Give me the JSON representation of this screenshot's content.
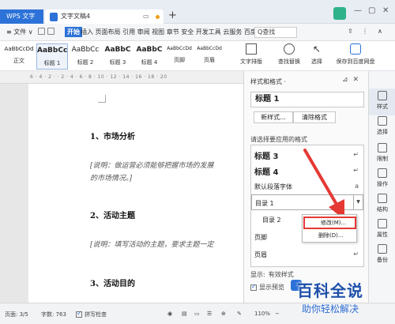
{
  "titlebar": {
    "app_tab": "WPS 文字",
    "doc_tab": "文字文稿4",
    "add_tab": "+"
  },
  "menubar": {
    "file": "≡ 文件 ∨",
    "start": "开始",
    "items": "插入  页面布局  引用  审阅  视图  章节  安全  开发工具  云服务  百度P",
    "search": "Q查找"
  },
  "ribbon": {
    "styles": [
      {
        "sample": "AaBbCcDd",
        "label": "正文"
      },
      {
        "sample": "AaBbCc",
        "label": "标题 1"
      },
      {
        "sample": "AaBbCc",
        "label": "标题 2"
      },
      {
        "sample": "AaBbC",
        "label": "标题 3"
      },
      {
        "sample": "AaBbC",
        "label": "标题 4"
      },
      {
        "sample": "AaBbCcDd",
        "label": "页脚"
      },
      {
        "sample": "AaBbCcDd",
        "label": "页眉"
      }
    ],
    "text_layout": "文字排版",
    "find_replace": "查找替换",
    "select": "选择",
    "save_baidu": "保存到百度网盘"
  },
  "ruler": {
    "marks": "6 · 4 · 2 · · 2 · 4 · 6 · 8 · 10 · 12 · 14 · 16 · 18 · 20"
  },
  "document": {
    "heading1": "1、市场分析",
    "note1_line1": "[说明：做运营必须能够把握市场的发展",
    "note1_line2": "的市场情况。]",
    "heading2": "2、活动主题",
    "note2": "[说明：填写活动的主题，要求主题一定",
    "heading3": "3、活动目的"
  },
  "pane": {
    "title": "样式和格式 ·",
    "current_style": "标题 1",
    "new_style": "新样式...",
    "clear_format": "清除格式",
    "apply_label": "请选择要应用的格式",
    "rows": [
      {
        "text": "标题 3",
        "mark": "↵"
      },
      {
        "text": "标题 4",
        "mark": "↵"
      },
      {
        "text": "默认段落字体",
        "mark": "a"
      },
      {
        "text": "目录 1",
        "mark": "▼"
      },
      {
        "text": "目录 2",
        "mark": ""
      },
      {
        "text": "页脚",
        "mark": ""
      },
      {
        "text": "页眉",
        "mark": "↵"
      }
    ],
    "show_label": "显示:",
    "show_value": "有效样式",
    "preview_label": "显示预览"
  },
  "context_menu": {
    "modify": "修改(M)...",
    "delete": "删除(D)..."
  },
  "sidebar": [
    {
      "label": "样式"
    },
    {
      "label": "选择"
    },
    {
      "label": "限制"
    },
    {
      "label": "操作"
    },
    {
      "label": "结构"
    },
    {
      "label": "属性"
    },
    {
      "label": "备份"
    }
  ],
  "status": {
    "page": "页面: 3/5",
    "words": "字数: 763",
    "spell": "拼写检查",
    "zoom": "110%",
    "zoom_minus": "−"
  },
  "watermark": {
    "title": "百科全说",
    "sub": "助你轻松解决"
  },
  "colors": {
    "accent": "#2c72d8",
    "highlight": "#e53935"
  }
}
